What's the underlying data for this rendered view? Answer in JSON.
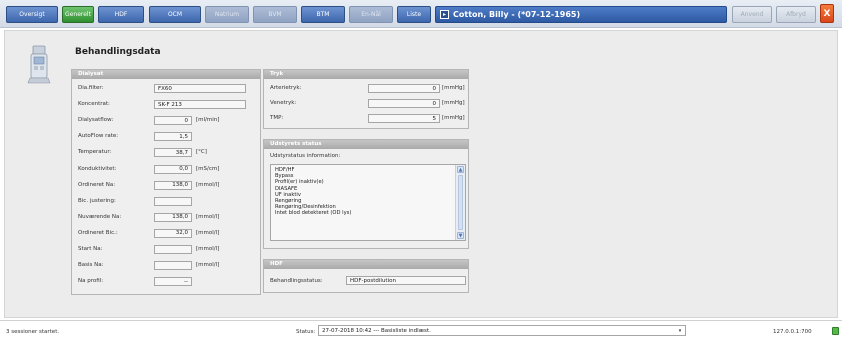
{
  "toolbar": {
    "tabs": [
      {
        "label": "Oversigt",
        "state": "normal"
      },
      {
        "label": "Generelt",
        "state": "active"
      },
      {
        "label": "HDF",
        "state": "normal"
      },
      {
        "label": "OCM",
        "state": "normal"
      },
      {
        "label": "Natrium",
        "state": "disabled"
      },
      {
        "label": "BVM",
        "state": "disabled"
      },
      {
        "label": "BTM",
        "state": "normal"
      },
      {
        "label": "En-Nål",
        "state": "disabled"
      },
      {
        "label": "Liste",
        "state": "normal"
      }
    ],
    "patient_name": "Cotton, Billy - (*07-12-1965)",
    "apply_label": "Anvend",
    "cancel_label": "Afbryd",
    "close_label": "X"
  },
  "page": {
    "title": "Behandlingsdata"
  },
  "dialysat": {
    "header": "Dialysat",
    "rows": [
      {
        "label": "Dia.filter:",
        "value": "FX60",
        "unit": ""
      },
      {
        "label": "Koncentrat:",
        "value": "SK-F 213",
        "unit": ""
      },
      {
        "label": "Dialysatflow:",
        "value": "0",
        "unit": "[ml/min]"
      },
      {
        "label": "AutoFlow rate:",
        "value": "1,5",
        "unit": ""
      },
      {
        "label": "Temperatur:",
        "value": "38,7",
        "unit": "[°C]"
      },
      {
        "label": "Konduktivitet:",
        "value": "0,0",
        "unit": "[mS/cm]"
      },
      {
        "label": "Ordineret Na:",
        "value": "138,0",
        "unit": "[mmol/l]"
      },
      {
        "label": "Bic. justering:",
        "value": "",
        "unit": ""
      },
      {
        "label": "Nuværende Na:",
        "value": "138,0",
        "unit": "[mmol/l]"
      },
      {
        "label": "Ordineret Bic.:",
        "value": "32,0",
        "unit": "[mmol/l]"
      },
      {
        "label": "Start Na:",
        "value": "",
        "unit": "[mmol/l]"
      },
      {
        "label": "Basis Na:",
        "value": "",
        "unit": "[mmol/l]"
      },
      {
        "label": "Na profil:",
        "value": "--",
        "unit": ""
      }
    ]
  },
  "tryk": {
    "header": "Tryk",
    "rows": [
      {
        "label": "Arterietryk:",
        "value": "0",
        "unit": "[mmHg]"
      },
      {
        "label": "Venetryk:",
        "value": "0",
        "unit": "[mmHg]"
      },
      {
        "label": "TMP:",
        "value": "5",
        "unit": "[mmHg]"
      }
    ]
  },
  "udstyr": {
    "header": "Udstyrets status",
    "info_label": "Udstyrstatus information:",
    "items": [
      "HDF/HF",
      "Bypass",
      "Profil(er) inaktiv(e)",
      "DIASAFE",
      "UF inaktiv",
      "Rengøring",
      "Rengøring/Desinfektion",
      "Intet blod detekteret (OD lys)"
    ]
  },
  "hdf": {
    "header": "HDF",
    "label": "Behandlingsstatus:",
    "value": "HDF-postdilution"
  },
  "statusbar": {
    "sessions": "3 sessioner startet.",
    "status_label": "Status:",
    "status_value": "27-07-2018 10:42 --- Basisliste indlæst.",
    "server": "127.0.0.1:700"
  }
}
